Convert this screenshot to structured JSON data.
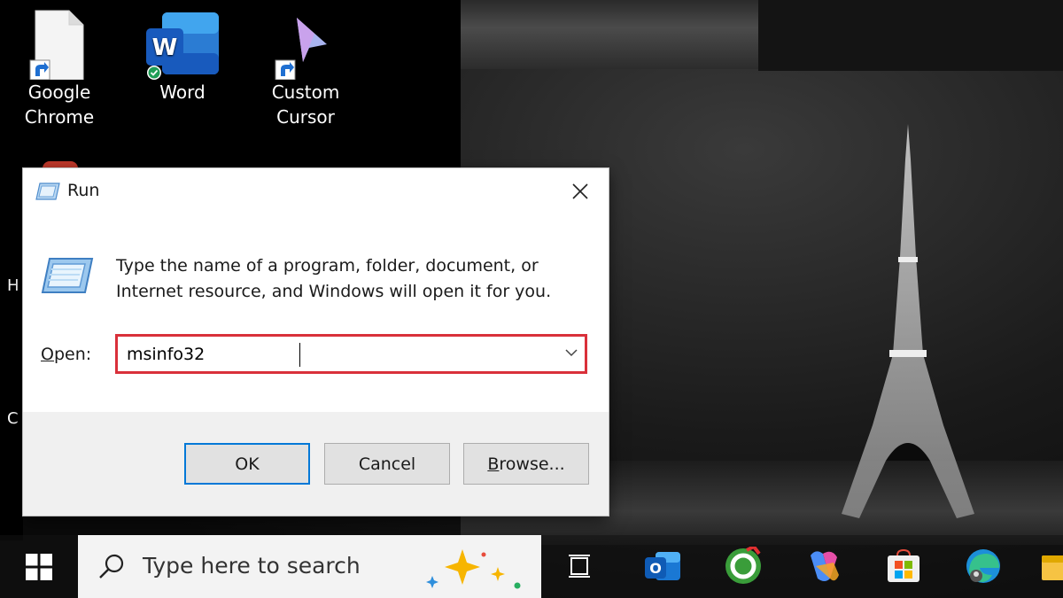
{
  "desktop": {
    "icons": [
      {
        "label": "Google\nChrome",
        "icon": "google-chrome-shortcut-icon"
      },
      {
        "label": "Word",
        "icon": "word-icon"
      },
      {
        "label": "Custom\nCursor",
        "icon": "custom-cursor-icon"
      }
    ],
    "partial_labels": [
      "H",
      "C"
    ]
  },
  "run_dialog": {
    "title": "Run",
    "description": "Type the name of a program, folder, document, or Internet resource, and Windows will open it for you.",
    "open_label_prefix": "O",
    "open_label_rest": "pen:",
    "open_value": "msinfo32",
    "buttons": {
      "ok": "OK",
      "cancel": "Cancel",
      "browse_prefix": "B",
      "browse_rest": "rowse..."
    },
    "highlight_color": "#d9303a",
    "accent_color": "#0078d7"
  },
  "taskbar": {
    "search_placeholder": "Type here to search",
    "apps": [
      "task-view-icon",
      "outlook-icon",
      "ccleaner-icon",
      "copilot-icon",
      "microsoft-store-icon",
      "edge-icon",
      "file-explorer-icon"
    ]
  }
}
